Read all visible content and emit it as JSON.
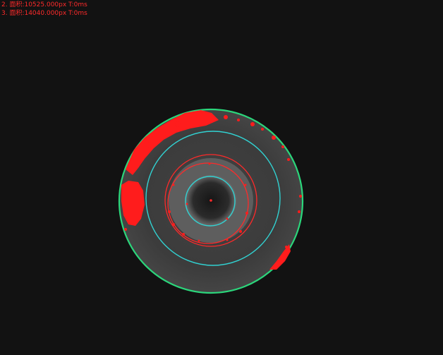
{
  "measurement_lines": [
    "2. 面积:10525.000px  T:0ms",
    "3. 面积:14040.000px  T:0ms"
  ],
  "colors": {
    "background": "#121212",
    "disk_fill": "#3a3a3a",
    "text": "#ff2a2a",
    "outer_ring": "#2bd67b",
    "inner_ring": "#31d2d2",
    "detect_ring": "#ff2a2a",
    "defect": "#ff1c1c"
  }
}
